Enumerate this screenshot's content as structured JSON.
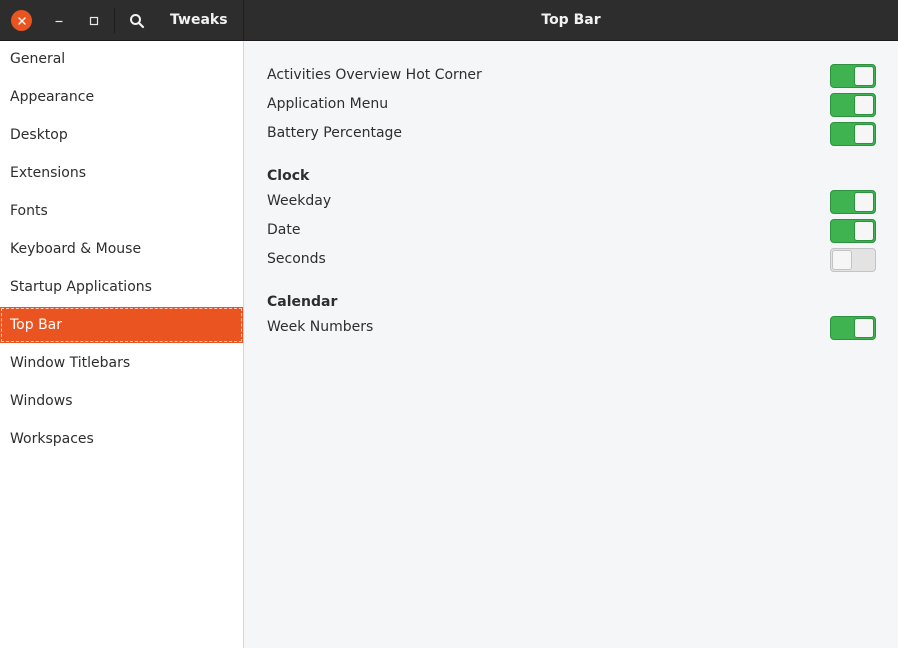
{
  "window": {
    "app_title": "Tweaks",
    "page_title": "Top Bar",
    "accent_color": "#e95420",
    "switch_on_color": "#3eb34f"
  },
  "sidebar": {
    "items": [
      {
        "label": "General"
      },
      {
        "label": "Appearance"
      },
      {
        "label": "Desktop"
      },
      {
        "label": "Extensions"
      },
      {
        "label": "Fonts"
      },
      {
        "label": "Keyboard & Mouse"
      },
      {
        "label": "Startup Applications"
      },
      {
        "label": "Top Bar",
        "selected": true
      },
      {
        "label": "Window Titlebars"
      },
      {
        "label": "Windows"
      },
      {
        "label": "Workspaces"
      }
    ]
  },
  "settings": {
    "hot_corner": {
      "label": "Activities Overview Hot Corner",
      "enabled": true
    },
    "app_menu": {
      "label": "Application Menu",
      "enabled": true
    },
    "battery": {
      "label": "Battery Percentage",
      "enabled": true
    },
    "clock_header": "Clock",
    "weekday": {
      "label": "Weekday",
      "enabled": true
    },
    "date": {
      "label": "Date",
      "enabled": true
    },
    "seconds": {
      "label": "Seconds",
      "enabled": false
    },
    "calendar_header": "Calendar",
    "week_numbers": {
      "label": "Week Numbers",
      "enabled": true
    }
  }
}
